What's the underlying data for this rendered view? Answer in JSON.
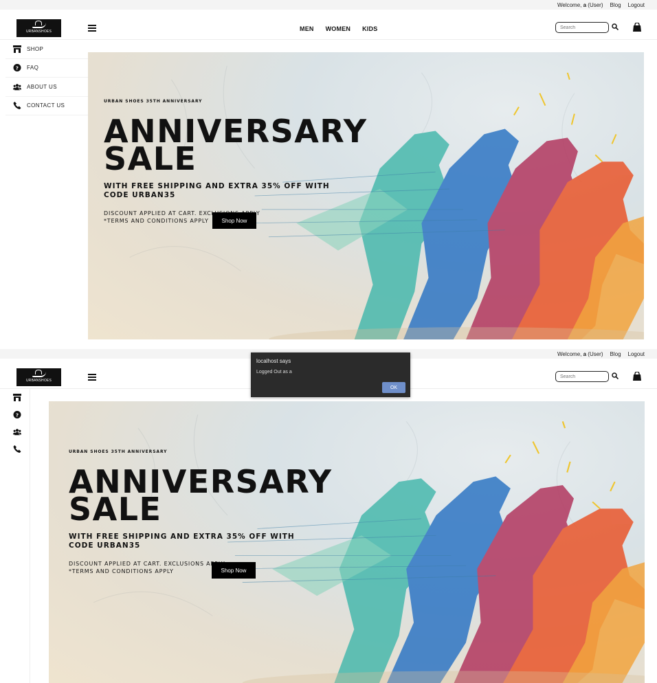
{
  "topbar": {
    "welcome_prefix": "Welcome, ",
    "username": "a",
    "role": " (User)",
    "blog": "Blog",
    "logout": "Logout"
  },
  "brand": {
    "logo_text": "URBANSHOES"
  },
  "nav": {
    "men": "MEN",
    "women": "WOMEN",
    "kids": "KIDS"
  },
  "search": {
    "placeholder": "Search"
  },
  "sidebar": {
    "items": [
      {
        "label": "SHOP",
        "icon": "store-icon"
      },
      {
        "label": "FAQ",
        "icon": "question-circle-icon"
      },
      {
        "label": "ABOUT US",
        "icon": "users-icon"
      },
      {
        "label": "CONTACT US",
        "icon": "phone-icon"
      }
    ]
  },
  "hero": {
    "eyebrow": "URBAN SHOES 35TH ANNIVERSARY",
    "headline_1": "ANNIVERSARY",
    "headline_2": "SALE",
    "tagline": "WITH FREE SHIPPING AND EXTRA 35% OFF WITH CODE URBAN35",
    "fine_1": "DISCOUNT APPLIED AT CART. EXCLUSIONS APPLY",
    "fine_2": "*TERMS AND CONDITIONS APPLY",
    "button": "Shop Now"
  },
  "dialog": {
    "title": "localhost says",
    "message": "Logged Out as a",
    "ok": "OK"
  },
  "colors": {
    "accent_dark": "#111111",
    "dialog_bg": "#2b2b2b",
    "dialog_button": "#6f8fca"
  }
}
